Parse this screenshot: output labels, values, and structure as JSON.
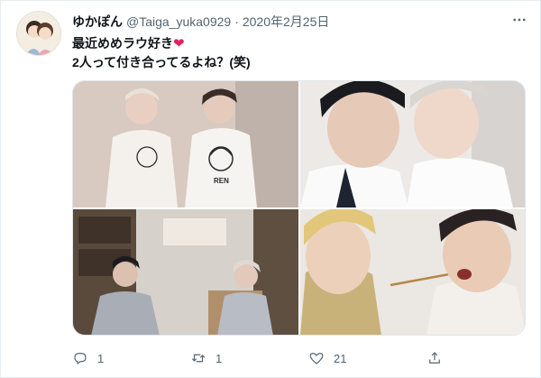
{
  "tweet": {
    "display_name": "ゆかぽん",
    "handle": "@Taiga_yuka0929",
    "separator": "·",
    "date": "2020年2月25日",
    "text_line1": "最近めめラウ好き",
    "text_line2": "2人って付き合ってるよね？(笑)",
    "heart": "❤"
  },
  "media": {
    "photos": [
      {
        "label": "RENのTシャツ",
        "printed_text": "REN"
      },
      {
        "label": "two performers close-up"
      },
      {
        "label": "performers in grey blazers"
      },
      {
        "label": "feeding with chopsticks"
      }
    ]
  },
  "actions": {
    "reply_count": "1",
    "retweet_count": "1",
    "like_count": "21"
  },
  "icons": [
    "more-icon",
    "reply-icon",
    "retweet-icon",
    "like-icon",
    "share-icon"
  ],
  "colors": {
    "secondary": "#536471",
    "heart": "#e0245e",
    "text": "#0f1419"
  }
}
